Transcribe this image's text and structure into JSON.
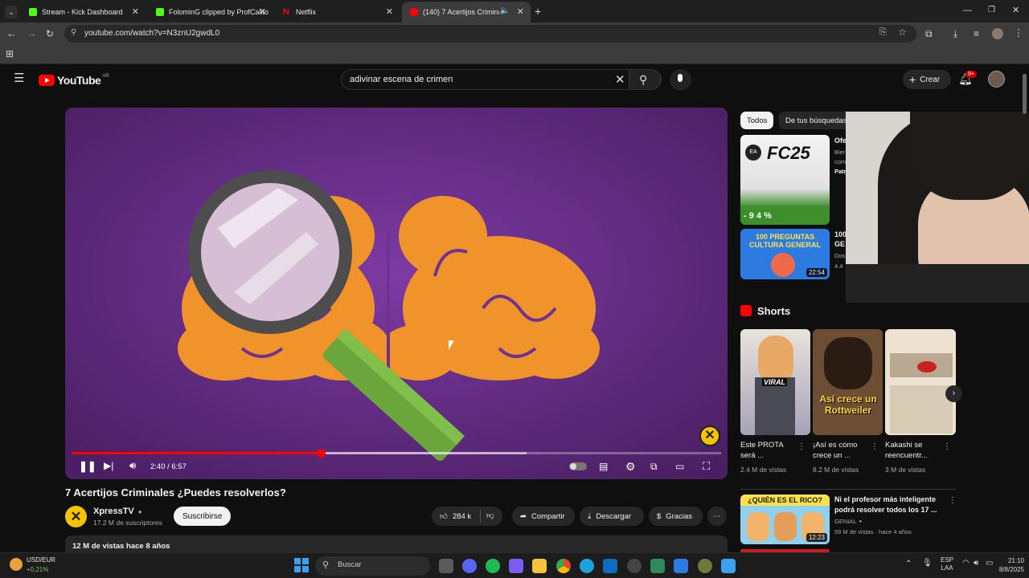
{
  "browser": {
    "tabs": [
      {
        "title": "Stream - Kick Dashboard",
        "color": "#53fc18"
      },
      {
        "title": "FolominG clipped by ProfCalito",
        "color": "#53fc18"
      },
      {
        "title": "Netflix",
        "color": "#e50914"
      },
      {
        "title": "(140) 7 Acertijos Criminales",
        "color": "#ff0000"
      }
    ],
    "url": "youtube.com/watch?v=N3znU2gwdL0"
  },
  "youtube": {
    "logo": "YouTube",
    "region": "AR",
    "search_value": "adivinar escena de crimen",
    "create_label": "Crear",
    "notif_badge": "9+"
  },
  "player": {
    "time": "2:40 / 6:57",
    "progress_fraction": 0.384,
    "accent": "#ff0000",
    "bg": "#6e3291"
  },
  "video": {
    "title": "7 Acertijos Criminales ¿Puedes resolverlos?",
    "channel": "XpressTV",
    "subscribers": "17.2 M de suscriptores",
    "subscribe_label": "Suscribirse",
    "likes": "284 k",
    "share": "Compartir",
    "download": "Descargar",
    "thanks": "Gracias",
    "views": "12 M de vistas  hace 8 años"
  },
  "sidebar": {
    "chips": [
      "Todos",
      "De tus búsquedas"
    ],
    "rel1": {
      "title": "Ofe",
      "meta1": "Bier",
      "meta2": "com",
      "channel": "Patr",
      "badge": "- 9 4 %",
      "thumb_text": "FC25"
    },
    "rel2": {
      "title": "100",
      "title2": "GE",
      "meta1": "Dos",
      "meta2": "4.4",
      "duration": "22:54",
      "thumb_text": "100 PREGUNTAS CULTURA GENERAL"
    },
    "shorts_label": "Shorts",
    "shorts": [
      {
        "title": "Este PROTA será ...",
        "views": "2.4 M de vistas",
        "overlay": "VIRAL"
      },
      {
        "title": "¡Así es como crece un ...",
        "views": "8.2 M de vistas",
        "overlay": "Así crece un Rottweiler"
      },
      {
        "title": "Kakashi se reencuentr...",
        "views": "3 M de vistas",
        "overlay": ""
      }
    ],
    "rel3": {
      "title": "Ni el profesor más inteligente podrá resolver todos los 17 ...",
      "channel": "GENIAL",
      "meta": "59 M de vistas · hace 4 años",
      "duration": "12:23",
      "thumb_text": "¿QUIÉN ES EL RICO?"
    }
  },
  "taskbar": {
    "ticker": "USD/EUR",
    "ticker_change": "+0,21%",
    "search": "Buscar",
    "lang1": "ESP",
    "lang2": "LAA",
    "time": "21:10",
    "date": "8/8/2025"
  }
}
